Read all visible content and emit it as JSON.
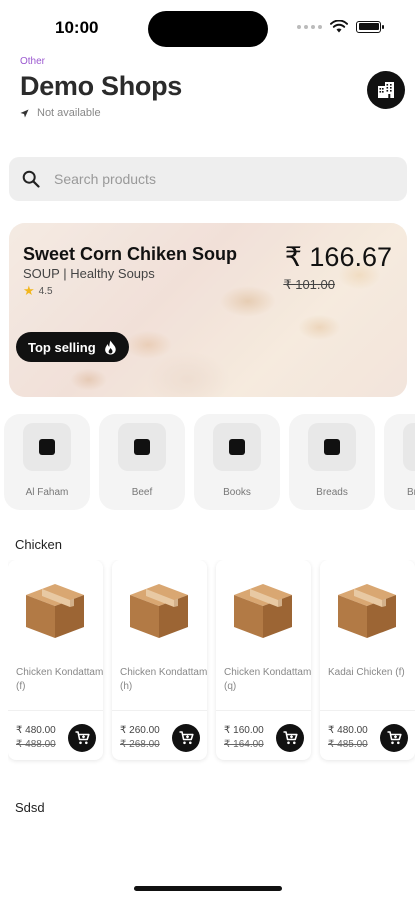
{
  "status": {
    "time": "10:00"
  },
  "header": {
    "category": "Other",
    "title": "Demo Shops",
    "location": "Not available"
  },
  "search": {
    "placeholder": "Search products"
  },
  "banner": {
    "product_name": "Sweet Corn Chiken Soup",
    "category": "SOUP | Healthy Soups",
    "rating": "4.5",
    "price": "₹ 166.67",
    "old_price": "₹ 101.00",
    "badge": "Top selling"
  },
  "categories": [
    {
      "label": "Al Faham"
    },
    {
      "label": "Beef"
    },
    {
      "label": "Books"
    },
    {
      "label": "Breads"
    },
    {
      "label": "Broasted"
    }
  ],
  "sections": [
    {
      "title": "Chicken",
      "products": [
        {
          "name": "Chicken Kondattam (f)",
          "price": "₹ 480.00",
          "mrp": "₹ 488.00"
        },
        {
          "name": "Chicken Kondattam (h)",
          "price": "₹ 260.00",
          "mrp": "₹ 268.00"
        },
        {
          "name": "Chicken Kondattam (q)",
          "price": "₹ 160.00",
          "mrp": "₹ 164.00"
        },
        {
          "name": "Kadai Chicken (f)",
          "price": "₹ 480.00",
          "mrp": "₹ 485.00"
        }
      ]
    },
    {
      "title": "Sdsd",
      "products": []
    }
  ],
  "colors": {
    "accent": "#111111",
    "category_label": "#9b59d0",
    "star": "#f2b61d"
  },
  "icons": {
    "search": "search-icon",
    "location": "navigation-arrow-icon",
    "shop": "building-icon",
    "fire": "fire-icon",
    "cart": "cart-icon",
    "product": "box-icon"
  }
}
